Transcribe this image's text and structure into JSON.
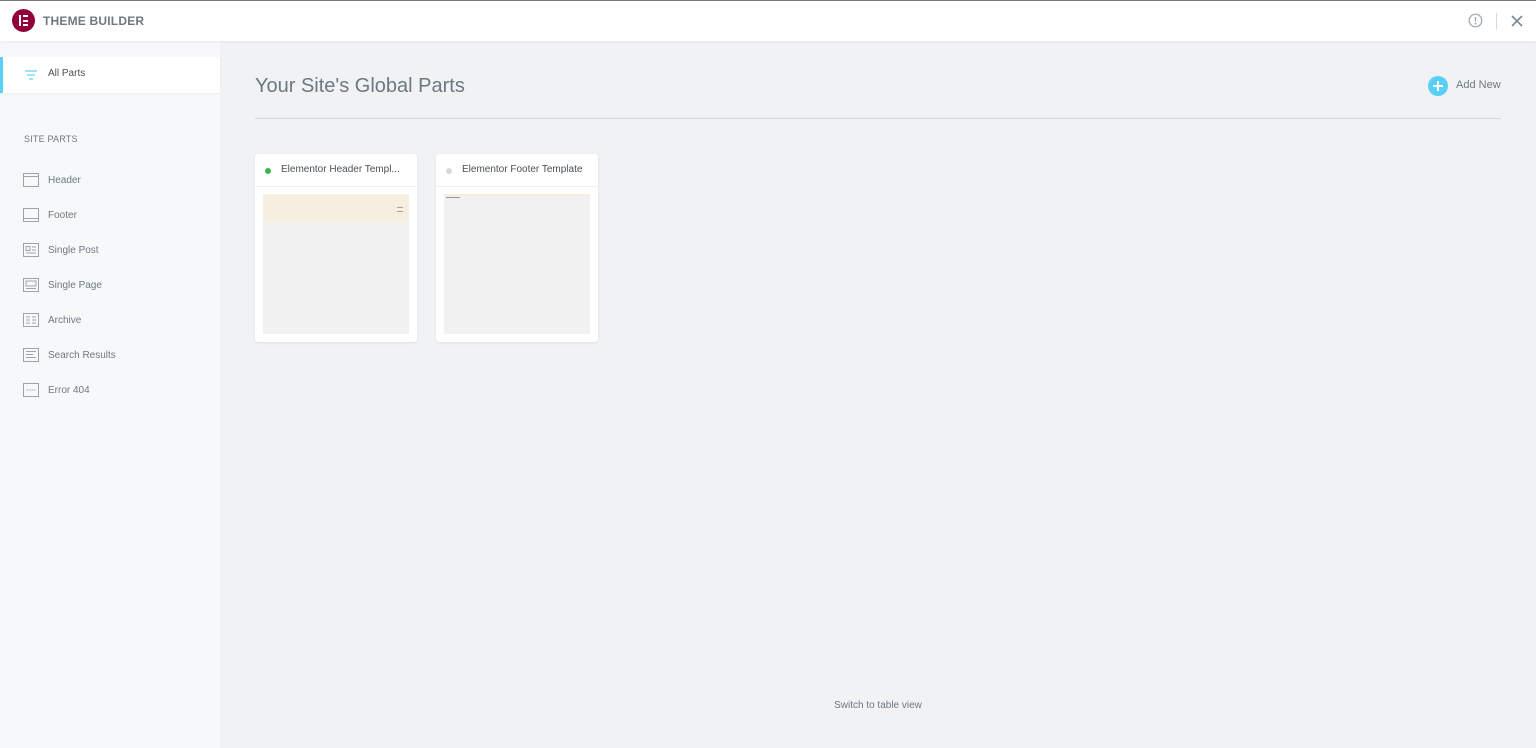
{
  "app": {
    "title": "THEME BUILDER",
    "brand_color": "#92003b",
    "accent_color": "#58d0f5"
  },
  "topbar": {
    "info_icon": "info-icon",
    "close_icon": "close-icon"
  },
  "sidebar": {
    "all_parts": {
      "label": "All Parts",
      "icon": "filter-lines-icon"
    },
    "section_title": "SITE PARTS",
    "items": [
      {
        "label": "Header",
        "icon": "header-layout-icon"
      },
      {
        "label": "Footer",
        "icon": "footer-layout-icon"
      },
      {
        "label": "Single Post",
        "icon": "single-post-icon"
      },
      {
        "label": "Single Page",
        "icon": "single-page-icon"
      },
      {
        "label": "Archive",
        "icon": "archive-icon"
      },
      {
        "label": "Search Results",
        "icon": "search-results-icon"
      },
      {
        "label": "Error 404",
        "icon": "error-404-icon"
      }
    ]
  },
  "main": {
    "title": "Your Site's Global Parts",
    "add_new_label": "Add New",
    "cards": [
      {
        "name": "Elementor Header Templ...",
        "status_color": "#39b54a"
      },
      {
        "name": "Elementor Footer Template",
        "status_color": "#d5d8dc"
      }
    ],
    "switch_view_label": "Switch to table view"
  }
}
